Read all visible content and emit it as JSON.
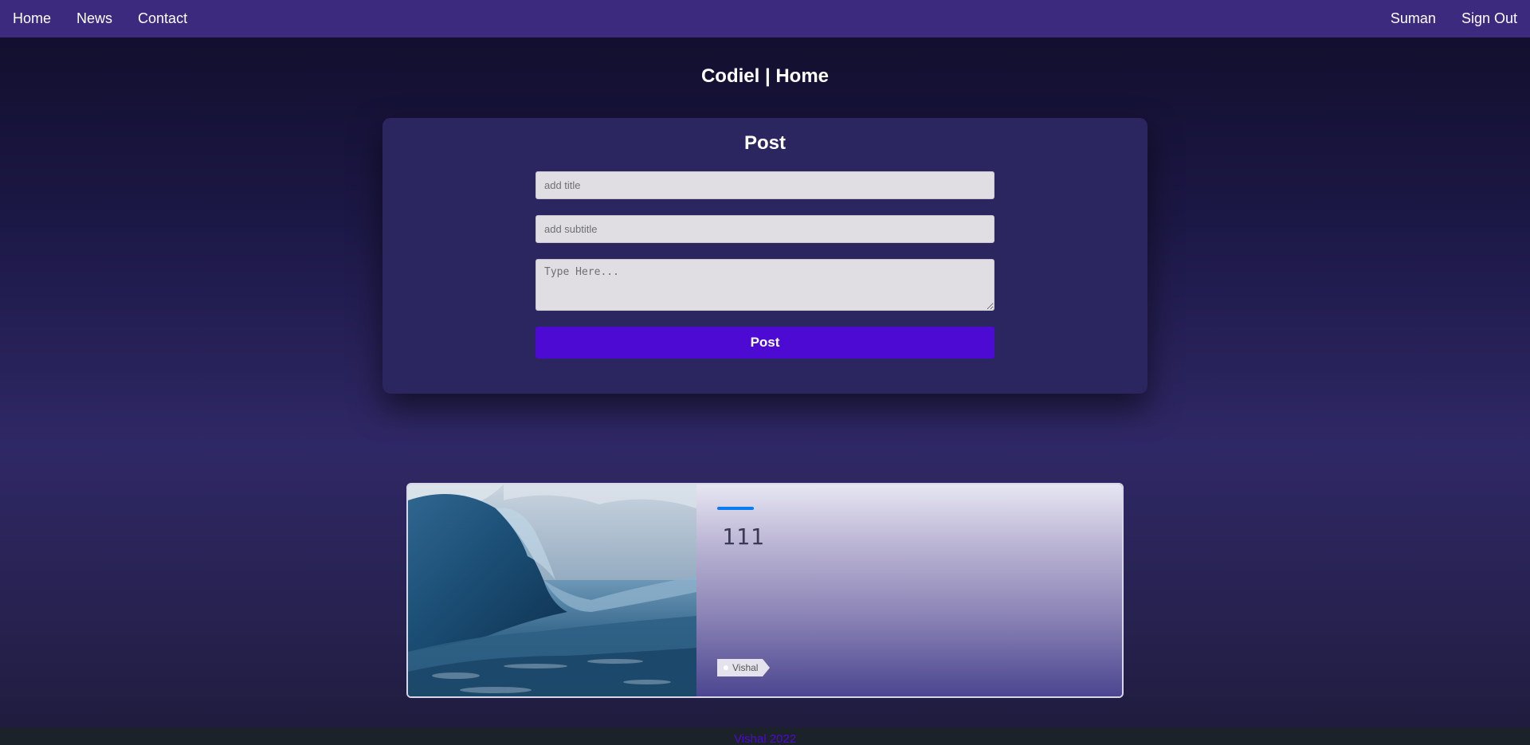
{
  "nav": {
    "left": [
      "Home",
      "News",
      "Contact"
    ],
    "user": "Suman",
    "signout": "Sign Out"
  },
  "page": {
    "title": "Codiel | Home"
  },
  "post_form": {
    "title": "Post",
    "title_placeholder": "add title",
    "subtitle_placeholder": "add subtitle",
    "body_placeholder": "Type Here...",
    "submit_label": "Post"
  },
  "blog_card": {
    "title": "111",
    "author": "Vishal",
    "image": "ocean-wave-photo"
  },
  "footer": {
    "text": "Vishal 2022"
  },
  "colors": {
    "navbar": "#3b2a7d",
    "card": "#2b2560",
    "button": "#4d0ad3",
    "accent": "#0a7bf0"
  }
}
